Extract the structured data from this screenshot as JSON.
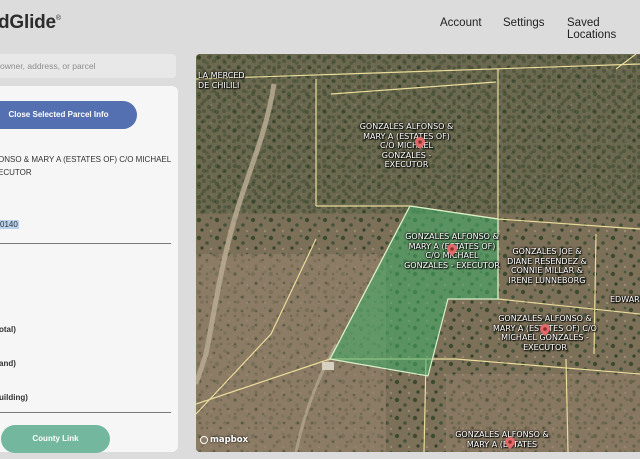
{
  "app": {
    "logo": "dGlide",
    "trademark": "®"
  },
  "nav": {
    "account": "Account",
    "settings": "Settings",
    "saved_locations": "Saved Locations"
  },
  "search": {
    "placeholder": "owner, address, or parcel"
  },
  "panel": {
    "close_button": "Close Selected Parcel Info",
    "owner_line1": "ONSO & MARY A (ESTATES OF) C/O MICHAEL",
    "owner_line2": "ECUTOR",
    "parcel_id": "0140",
    "label_total": "otal)",
    "label_land": "and)",
    "label_building": "uilding)",
    "county_button": "County Link"
  },
  "map": {
    "labels": [
      "LA MERCED DE CHILILI",
      "GONZALES ALFONSO & MARY A (ESTATES OF) C/O MICHAEL GONZALES - EXECUTOR",
      "GONZALES ALFONSO & MARY A (ESTATES OF) C/O MICHAEL GONZALES - EXECUTOR",
      "GONZALES JOE & DIANE RESENDEZ & CONNIE MILLAR & IRENE LUNNEBORG",
      "GONZALES ALFONSO & MARY A (ESTATES OF) C/O MICHAEL GONZALES - EXECUTOR",
      "EDWAR",
      "GONZALES ALFONSO & MARY A (ESTATES"
    ],
    "attribution": "mapbox",
    "colors": {
      "selected_fill": "#3fae6a",
      "parcel_line": "#e9dc9a",
      "pin": "#e06a6a"
    }
  }
}
